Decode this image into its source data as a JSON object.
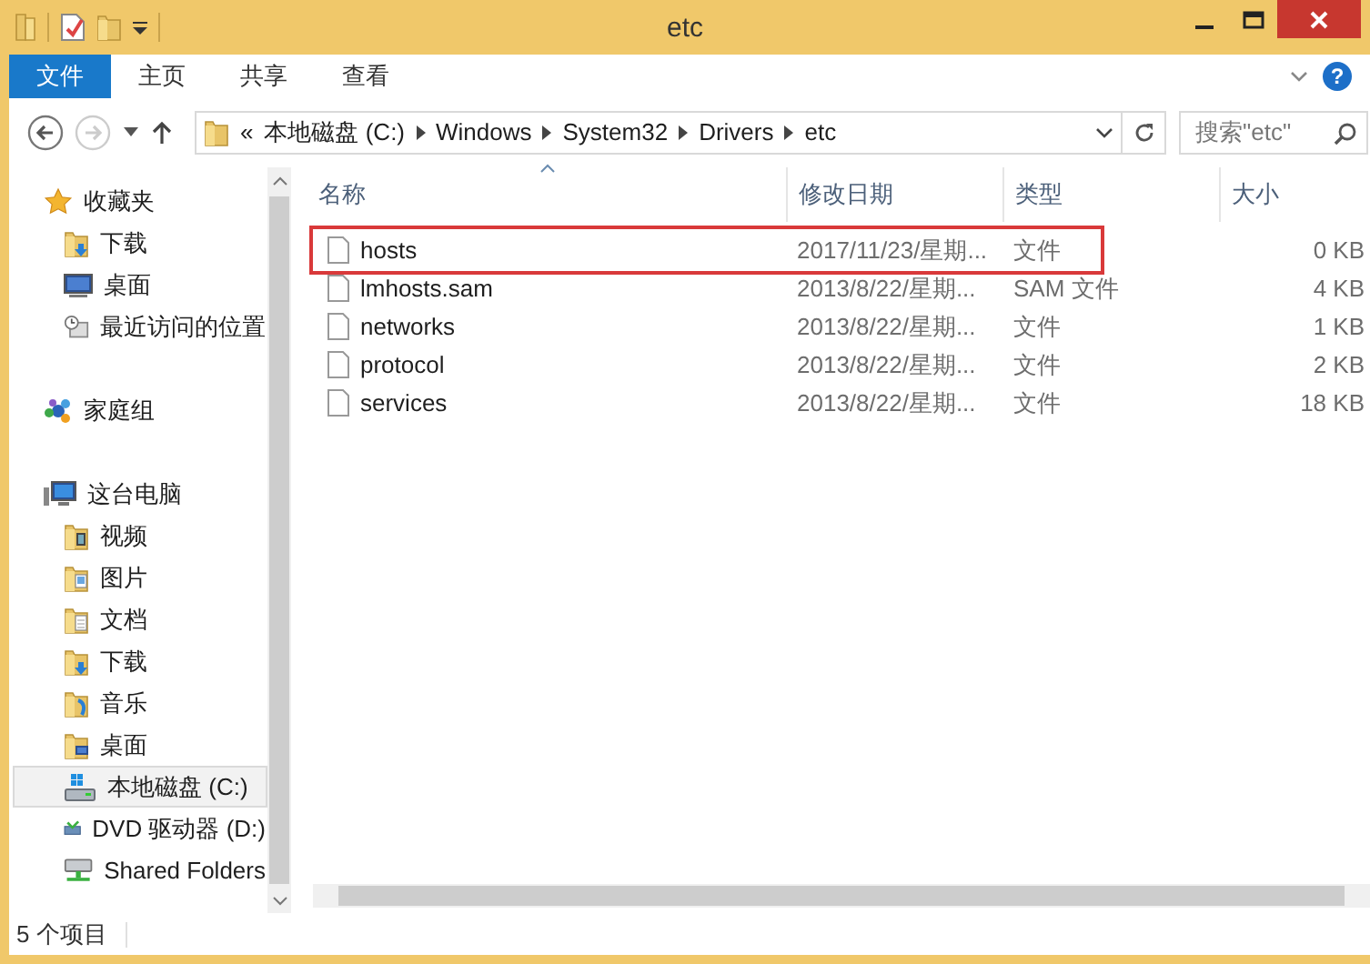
{
  "window": {
    "title": "etc"
  },
  "ribbon": {
    "tabs": [
      {
        "label": "文件",
        "selected": true
      },
      {
        "label": "主页",
        "selected": false
      },
      {
        "label": "共享",
        "selected": false
      },
      {
        "label": "查看",
        "selected": false
      }
    ],
    "help": "?"
  },
  "address": {
    "back_disabled": false,
    "forward_disabled": true,
    "overflow": "«",
    "crumbs": [
      "本地磁盘 (C:)",
      "Windows",
      "System32",
      "Drivers",
      "etc"
    ],
    "search": {
      "placeholder": "搜索\"etc\""
    }
  },
  "nav": [
    {
      "label": "收藏夹",
      "kind": "star",
      "selected": false,
      "children": [
        {
          "label": "下载",
          "kind": "folder-download",
          "selected": false
        },
        {
          "label": "桌面",
          "kind": "desktop",
          "selected": false
        },
        {
          "label": "最近访问的位置",
          "kind": "recent",
          "selected": false
        }
      ]
    },
    {
      "label": "家庭组",
      "kind": "homegroup",
      "selected": false
    },
    {
      "label": "这台电脑",
      "kind": "computer",
      "selected": false,
      "children": [
        {
          "label": "视频",
          "kind": "folder-video",
          "selected": false
        },
        {
          "label": "图片",
          "kind": "folder-pictures",
          "selected": false
        },
        {
          "label": "文档",
          "kind": "folder-docs",
          "selected": false
        },
        {
          "label": "下载",
          "kind": "folder-download",
          "selected": false
        },
        {
          "label": "音乐",
          "kind": "folder-music",
          "selected": false
        },
        {
          "label": "桌面",
          "kind": "folder-desktop",
          "selected": false
        },
        {
          "label": "本地磁盘 (C:)",
          "kind": "drive",
          "selected": true
        },
        {
          "label": "DVD 驱动器 (D:)",
          "kind": "dvd",
          "selected": false
        },
        {
          "label": "Shared Folders",
          "kind": "network",
          "selected": false
        }
      ]
    }
  ],
  "table": {
    "columns": [
      {
        "label": "名称",
        "sorted": true
      },
      {
        "label": "修改日期",
        "sorted": false
      },
      {
        "label": "类型",
        "sorted": false
      },
      {
        "label": "大小",
        "sorted": false
      }
    ],
    "rows": [
      {
        "name": "hosts",
        "date": "2017/11/23/星期...",
        "type": "文件",
        "size": "0 KB",
        "highlighted": true
      },
      {
        "name": "lmhosts.sam",
        "date": "2013/8/22/星期...",
        "type": "SAM 文件",
        "size": "4 KB",
        "highlighted": false
      },
      {
        "name": "networks",
        "date": "2013/8/22/星期...",
        "type": "文件",
        "size": "1 KB",
        "highlighted": false
      },
      {
        "name": "protocol",
        "date": "2013/8/22/星期...",
        "type": "文件",
        "size": "2 KB",
        "highlighted": false
      },
      {
        "name": "services",
        "date": "2013/8/22/星期...",
        "type": "文件",
        "size": "18 KB",
        "highlighted": false
      }
    ]
  },
  "status_bar": {
    "count": "5 个项目"
  }
}
